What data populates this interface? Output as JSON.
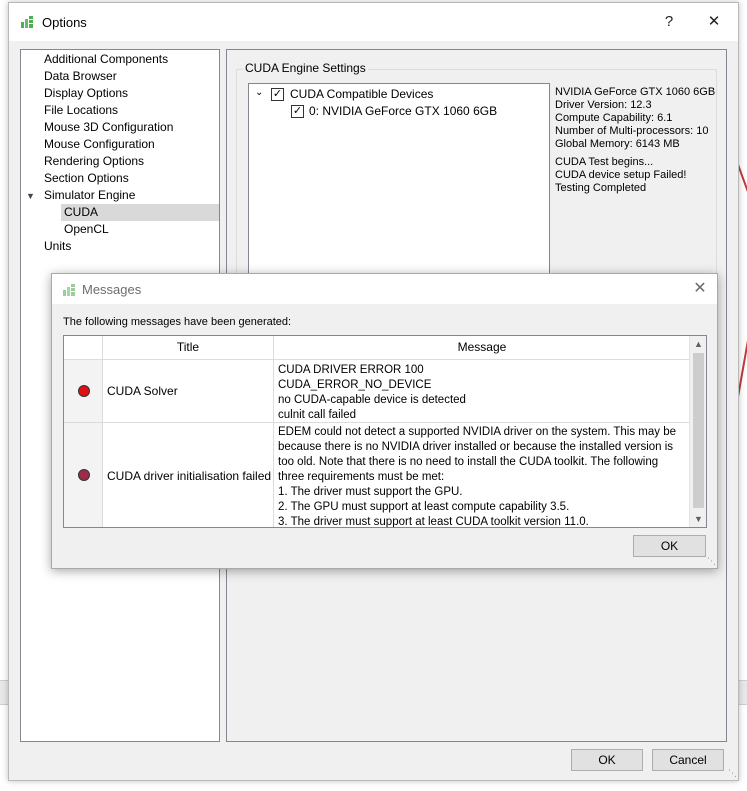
{
  "window": {
    "title": "Options",
    "help_label": "?",
    "close_label": "✕"
  },
  "tree": {
    "expand_icon": "chevron-down-icon",
    "items": [
      {
        "label": "Additional Components"
      },
      {
        "label": "Data Browser"
      },
      {
        "label": "Display Options"
      },
      {
        "label": "File Locations"
      },
      {
        "label": "Mouse 3D Configuration"
      },
      {
        "label": "Mouse Configuration"
      },
      {
        "label": "Rendering Options"
      },
      {
        "label": "Section Options"
      },
      {
        "label": "Simulator Engine"
      },
      {
        "label": "CUDA",
        "selected": true
      },
      {
        "label": "OpenCL"
      },
      {
        "label": "Units"
      }
    ]
  },
  "cuda": {
    "group_title": "CUDA Engine Settings",
    "root_label": "CUDA Compatible Devices",
    "device_label": "0: NVIDIA GeForce GTX 1060 6GB",
    "info": [
      "NVIDIA GeForce GTX 1060 6GB",
      "Driver Version: 12.3",
      "Compute Capability: 6.1",
      "Number of Multi-processors: 10",
      "Global Memory: 6143 MB"
    ],
    "test_log": [
      "CUDA Test begins...",
      "CUDA device setup Failed!",
      "Testing Completed"
    ]
  },
  "buttons": {
    "ok": "OK",
    "cancel": "Cancel"
  },
  "messages": {
    "title": "Messages",
    "close_label": "✕",
    "intro": "The following messages have been generated:",
    "columns": {
      "title": "Title",
      "message": "Message"
    },
    "rows": [
      {
        "title": "CUDA Solver",
        "color": "#e01010",
        "lines": [
          "CUDA DRIVER ERROR 100",
          "CUDA_ERROR_NO_DEVICE",
          "no CUDA-capable device is detected",
          "culnit call failed"
        ]
      },
      {
        "title": "CUDA driver initialisation failed",
        "color": "#9a2e4a",
        "lines": [
          "EDEM could not detect a supported NVIDIA driver on the system. This may be",
          "because there is no NVIDIA driver installed or because the installed version is",
          "too old. Note that there is no need to install the CUDA toolkit. The following",
          "three requirements must be met:",
          "1. The driver must support the GPU.",
          "2. The GPU must support at least compute capability 3.5.",
          "3. The driver must support at least CUDA toolkit version 11.0."
        ]
      }
    ],
    "ok": "OK"
  }
}
